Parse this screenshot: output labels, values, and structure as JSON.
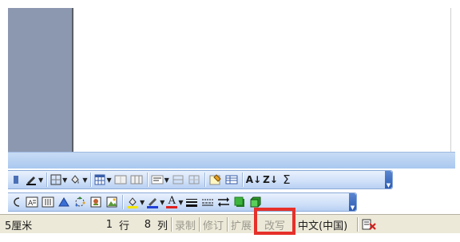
{
  "status_bar": {
    "unit_fragment": "5厘米",
    "line_value": "1",
    "line_label": "行",
    "col_value": "8",
    "col_label": "列",
    "rec": "录制",
    "trk": "修订",
    "ext": "扩展",
    "ovr": "改写",
    "language": "中文(中国)"
  },
  "toolbar_1": {
    "sort_ascending": "A↓",
    "sort_descending": "Z↓",
    "sum": "Σ"
  },
  "toolbar_2": {
    "font_color_letter": "A"
  },
  "colors": {
    "highlight": "#e6302a",
    "font_color": "#e02020",
    "highlight_yellow": "#f4e60a",
    "line_color_blue": "#1f3fd6"
  }
}
